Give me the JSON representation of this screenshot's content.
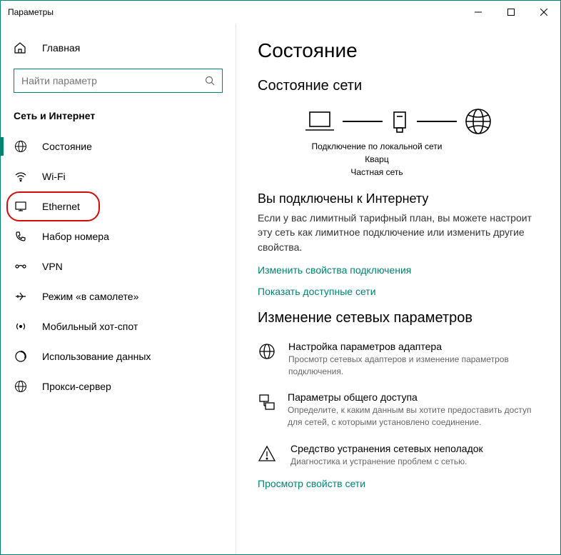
{
  "window": {
    "title": "Параметры"
  },
  "sidebar": {
    "home": "Главная",
    "search_placeholder": "Найти параметр",
    "category": "Сеть и Интернет",
    "items": [
      {
        "label": "Состояние"
      },
      {
        "label": "Wi-Fi"
      },
      {
        "label": "Ethernet"
      },
      {
        "label": "Набор номера"
      },
      {
        "label": "VPN"
      },
      {
        "label": "Режим «в самолете»"
      },
      {
        "label": "Мобильный хот-спот"
      },
      {
        "label": "Использование данных"
      },
      {
        "label": "Прокси-сервер"
      }
    ]
  },
  "content": {
    "title": "Состояние",
    "section1": "Состояние сети",
    "diagram": {
      "line1": "Подключение по локальной сети",
      "line2": "Кварц",
      "line3": "Частная сеть"
    },
    "connected_heading": "Вы подключены к Интернету",
    "connected_body": "Если у вас лимитный тарифный план, вы можете настроит эту сеть как лимитное подключение или изменить другие свойства.",
    "link_change_props": "Изменить свойства подключения",
    "link_show_nets": "Показать доступные сети",
    "section2": "Изменение сетевых параметров",
    "opts": [
      {
        "title": "Настройка параметров адаптера",
        "desc": "Просмотр сетевых адаптеров и изменение параметров подключения."
      },
      {
        "title": "Параметры общего доступа",
        "desc": "Определите, к каким данным вы хотите предоставить доступ для сетей, с которыми установлено соединение."
      },
      {
        "title": "Средство устранения сетевых неполадок",
        "desc": "Диагностика и устранение проблем с сетью."
      }
    ],
    "link_view_props": "Просмотр свойств сети"
  }
}
